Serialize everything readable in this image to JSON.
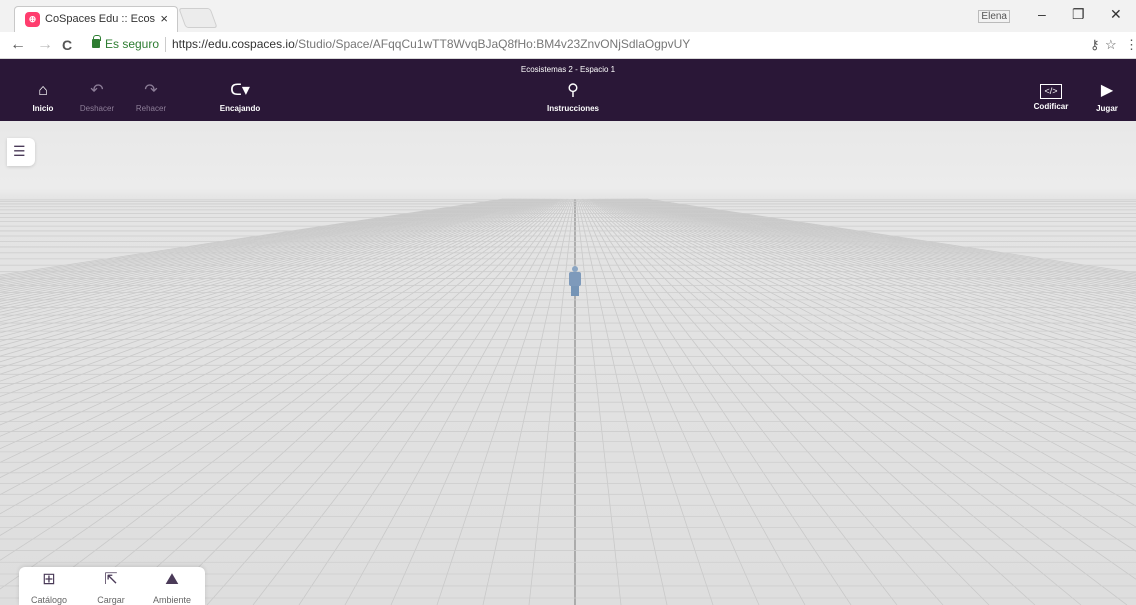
{
  "browser": {
    "tab_title": "CoSpaces Edu :: Ecosistemas",
    "tab_close": "×",
    "favicon_text": "⊕",
    "profile_label": "Elena",
    "window_controls": {
      "minimize": "–",
      "maximize": "❐",
      "close": "✕"
    },
    "nav": {
      "back": "←",
      "forward": "→",
      "reload": "C"
    },
    "secure_label": "Es seguro",
    "url_host": "https://edu.cospaces.io",
    "url_path": "/Studio/Space/AFqqCu1wTT8WvqBJaQ8fHo:BM4v23ZnvONjSdlaOgpvUY",
    "key_icon": "⚷",
    "star_icon": "☆",
    "menu_icon": "⋮"
  },
  "toolbar": {
    "space_title": "Ecosistemas 2 - Espacio 1",
    "home": {
      "label": "Inicio",
      "icon": "home-icon",
      "glyph": "⌂"
    },
    "undo": {
      "label": "Deshacer",
      "icon": "undo-icon",
      "glyph": "↶"
    },
    "redo": {
      "label": "Rehacer",
      "icon": "redo-icon",
      "glyph": "↷"
    },
    "snap": {
      "label": "Encajando",
      "icon": "magnet-icon",
      "glyph": "ᑕ▾"
    },
    "instructions": {
      "label": "Instrucciones",
      "icon": "instructions-icon",
      "glyph": "⚲"
    },
    "code": {
      "label": "Codificar",
      "icon": "code-icon",
      "glyph": "</>"
    },
    "play": {
      "label": "Jugar",
      "icon": "play-icon",
      "glyph": "▶"
    }
  },
  "scene": {
    "list_toggle_icon": "list-icon",
    "list_toggle_glyph": "☰"
  },
  "bottom_panel": {
    "catalog": {
      "label": "Catálogo",
      "icon": "catalog-icon",
      "glyph": "⊞"
    },
    "upload": {
      "label": "Cargar",
      "icon": "upload-icon",
      "glyph": "⇱"
    },
    "environment": {
      "label": "Ambiente",
      "icon": "environment-icon",
      "glyph": "⛰"
    }
  },
  "colors": {
    "toolbar_bg": "#2a1737",
    "secure_green": "#2e7d32",
    "favicon_pink": "#ff3d6e",
    "figure_blue": "#7e9abb"
  }
}
